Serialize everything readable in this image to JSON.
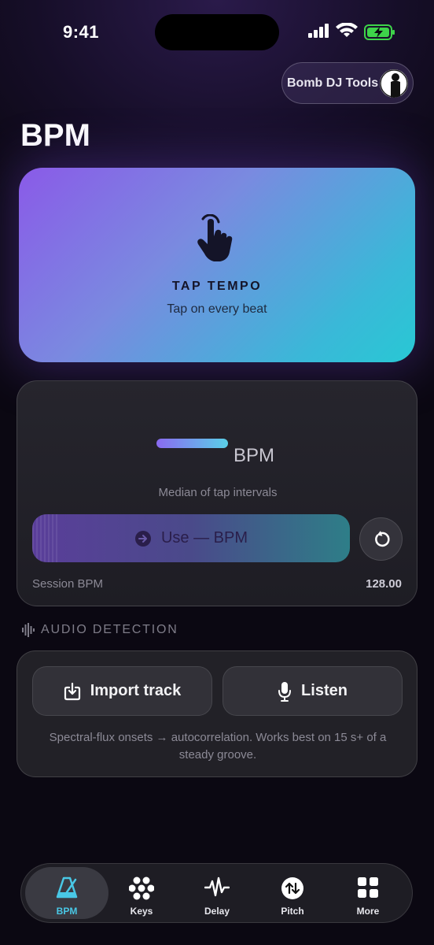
{
  "status_bar": {
    "time": "9:41"
  },
  "header": {
    "tools_label": "Bomb DJ Tools",
    "page_title": "BPM"
  },
  "tap_card": {
    "title": "TAP TEMPO",
    "subtitle": "Tap on every beat"
  },
  "result": {
    "unit": "BPM",
    "caption": "Median of tap intervals",
    "use_label": "Use — BPM",
    "session_label": "Session BPM",
    "session_value": "128.00"
  },
  "audio": {
    "section_title": "AUDIO DETECTION",
    "import_label": "Import track",
    "listen_label": "Listen",
    "description": "Spectral-flux onsets → autocorrelation. Works best on 15 s+ of a steady groove."
  },
  "tabs": [
    {
      "label": "BPM",
      "icon": "metronome-icon",
      "active": true
    },
    {
      "label": "Keys",
      "icon": "keys-icon"
    },
    {
      "label": "Delay",
      "icon": "waveform-icon"
    },
    {
      "label": "Pitch",
      "icon": "pitch-arrows-icon"
    },
    {
      "label": "More",
      "icon": "grid-icon"
    }
  ],
  "colors": {
    "accent": "#49c8e6",
    "purple": "#8a5ae8",
    "teal": "#28c8d4"
  }
}
